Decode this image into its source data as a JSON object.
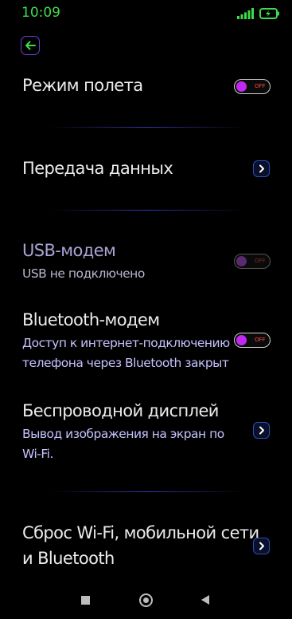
{
  "status_bar": {
    "time": "10:09",
    "signal_icon": "signal-bars-icon",
    "battery_icon": "battery-charging-icon",
    "accent_color": "#3ddc4a"
  },
  "header": {
    "back_icon": "back-arrow-icon"
  },
  "settings": [
    {
      "title": "Режим полета",
      "control": "toggle",
      "state": "OFF"
    },
    {
      "title": "Передача данных",
      "control": "chevron"
    },
    {
      "title": "USB-модем",
      "subtitle": "USB не подключено",
      "control": "toggle",
      "state": "OFF",
      "disabled": true
    },
    {
      "title": "Bluetooth-модем",
      "subtitle_lines": [
        "Доступ к интернет-подключению",
        "телефона через Bluetooth закрыт"
      ],
      "control": "toggle",
      "state": "OFF"
    },
    {
      "title": "Беспроводной дисплей",
      "subtitle_lines": [
        "Вывод изображения на экран по",
        "Wi-Fi."
      ],
      "control": "chevron"
    },
    {
      "title_lines": [
        "Сброс Wi-Fi, мобильной сети",
        "и Bluetooth"
      ],
      "control": "chevron"
    }
  ],
  "nav_bar": {
    "items": [
      "recents-square-icon",
      "home-circle-icon",
      "back-triangle-icon"
    ]
  },
  "colors": {
    "toggle_knob": "#c229f0",
    "toggle_off_text": "#ff4a4a",
    "subtitle": "#c6c2ff",
    "chevron_border": "#2a4fbf"
  }
}
